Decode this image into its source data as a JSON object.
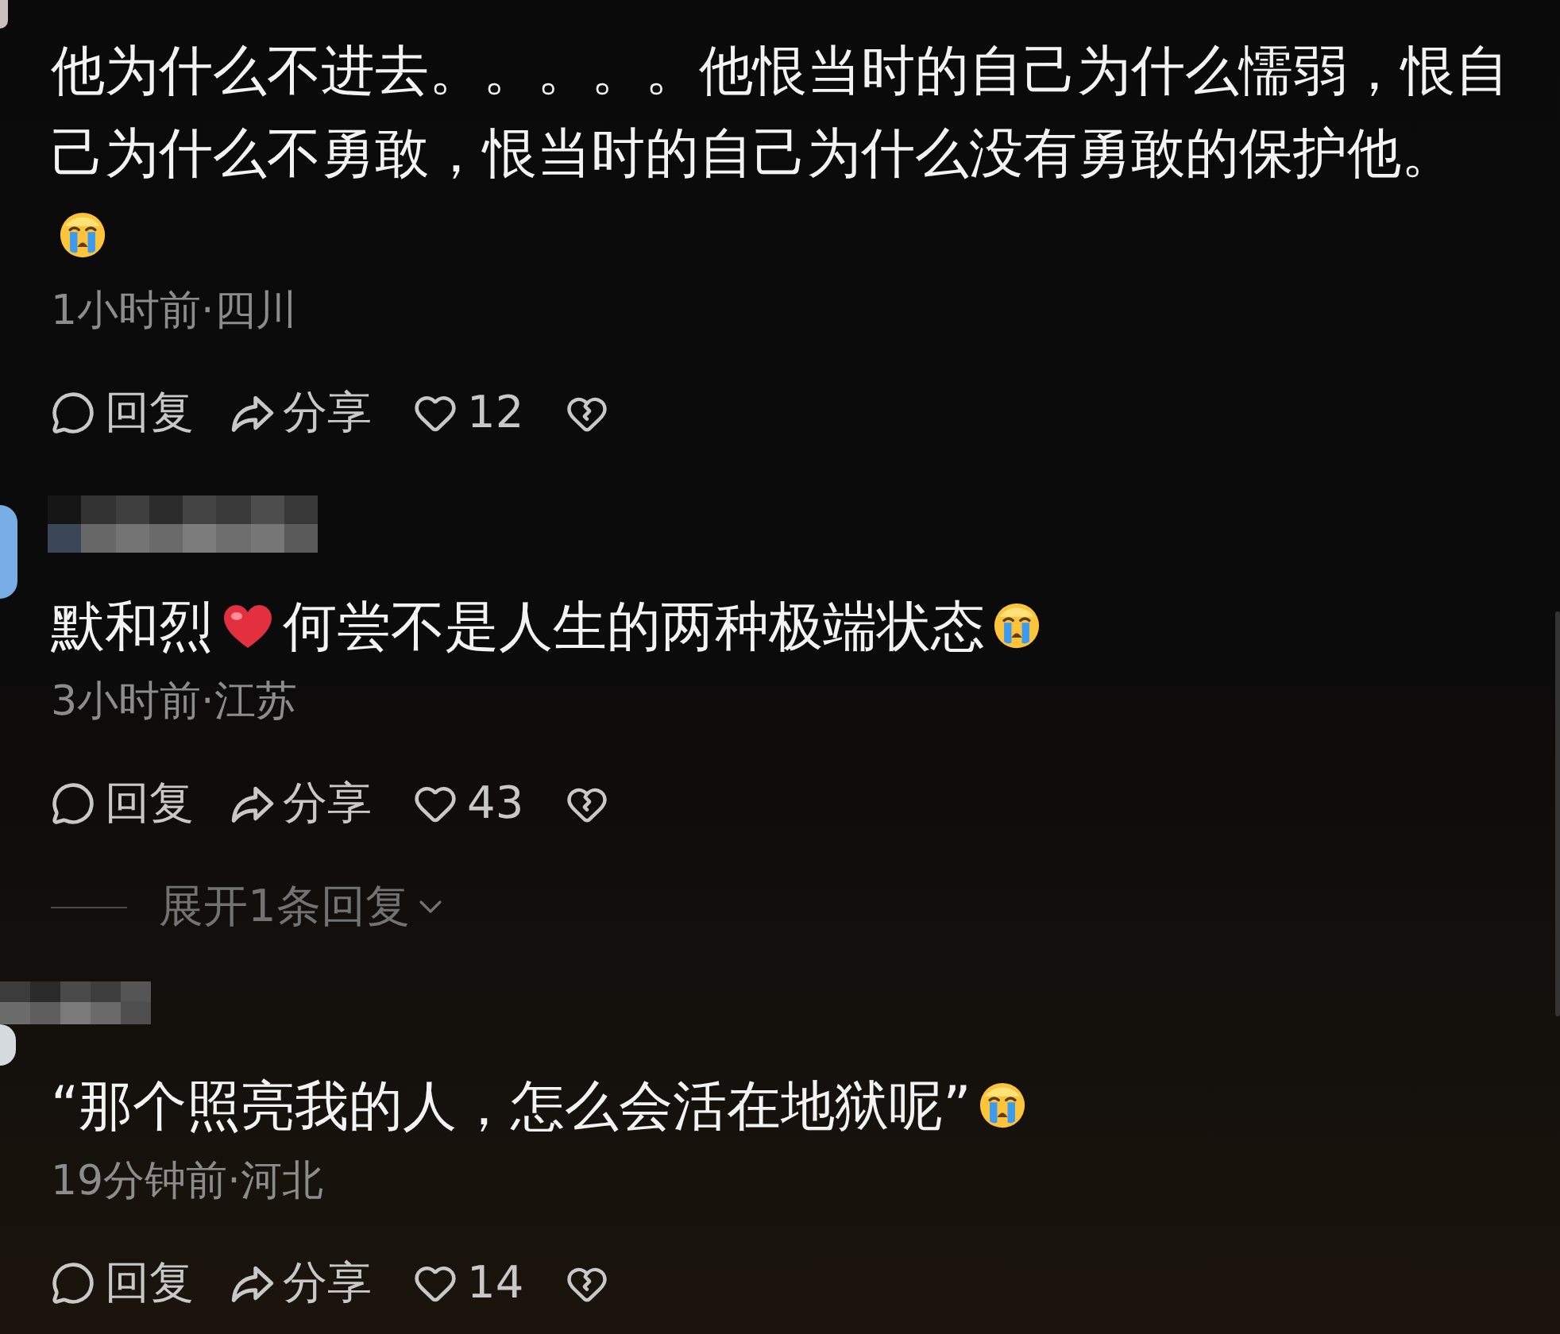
{
  "comments": [
    {
      "author_shown": false,
      "content": [
        {
          "kind": "text",
          "text": "他为什么不进去。。。。。他恨当时的自己为什么懦弱，恨自己为什么不勇敢，恨当时的自己为什么没有勇敢的保护他。"
        },
        {
          "kind": "crying_emoji"
        }
      ],
      "meta": "1小时前·四川",
      "actions": {
        "reply": "回复",
        "share": "分享",
        "likes": "12"
      }
    },
    {
      "author_shown": true,
      "content": [
        {
          "kind": "text",
          "text": "默和烈"
        },
        {
          "kind": "heart_emoji"
        },
        {
          "kind": "text",
          "text": "何尝不是人生的两种极端状态"
        },
        {
          "kind": "crying_emoji"
        }
      ],
      "meta": "3小时前·江苏",
      "actions": {
        "reply": "回复",
        "share": "分享",
        "likes": "43"
      },
      "replies_toggle": "展开1条回复"
    },
    {
      "author_shown": true,
      "content": [
        {
          "kind": "text",
          "text": "“那个照亮我的人，怎么会活在地狱呢”"
        },
        {
          "kind": "crying_emoji"
        }
      ],
      "meta": "19分钟前·河北",
      "actions": {
        "reply": "回复",
        "share": "分享",
        "likes": "14"
      }
    }
  ]
}
